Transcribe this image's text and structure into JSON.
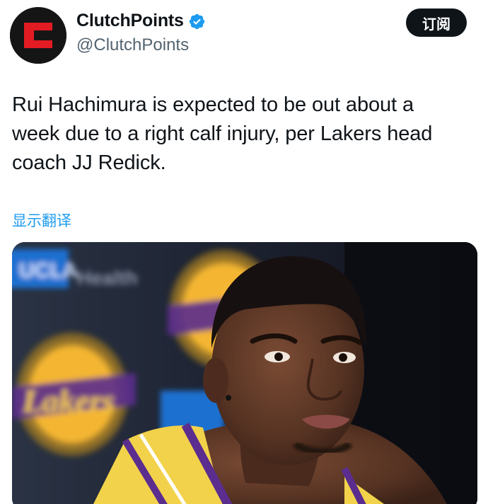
{
  "account": {
    "display_name": "ClutchPoints",
    "handle": "@ClutchPoints",
    "avatar_icon": "clutchpoints-logo-icon",
    "verified_icon": "verified-badge-icon",
    "accent_color": "#1d9bf0",
    "brand_color": "#e31b23"
  },
  "actions": {
    "subscribe_label": "订阅"
  },
  "tweet": {
    "text": "Rui Hachimura is expected to be out about a\nweek due to a right calf injury, per Lakers head\ncoach JJ Redick.",
    "translate_label": "显示翻译"
  },
  "media": {
    "type": "photo"
  }
}
